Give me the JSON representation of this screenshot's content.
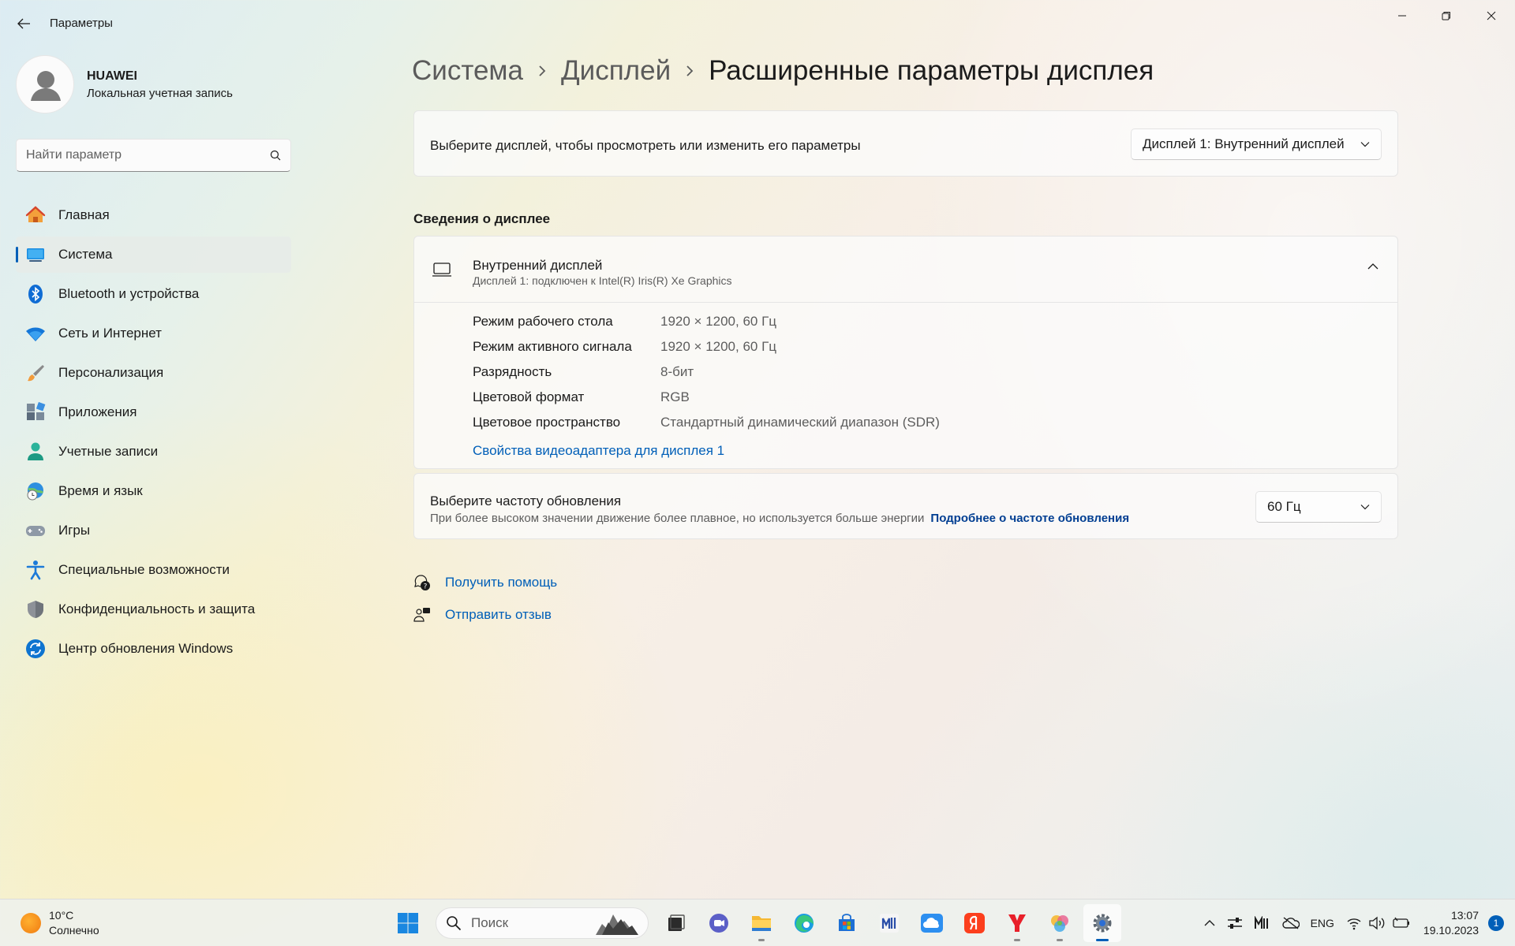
{
  "window": {
    "title": "Параметры"
  },
  "profile": {
    "name": "HUAWEI",
    "account_type": "Локальная учетная запись"
  },
  "search": {
    "placeholder": "Найти параметр"
  },
  "nav": {
    "items": [
      {
        "label": "Главная",
        "icon": "home-icon"
      },
      {
        "label": "Система",
        "icon": "system-icon",
        "active": true
      },
      {
        "label": "Bluetooth и устройства",
        "icon": "bluetooth-icon"
      },
      {
        "label": "Сеть и Интернет",
        "icon": "wifi-icon"
      },
      {
        "label": "Персонализация",
        "icon": "brush-icon"
      },
      {
        "label": "Приложения",
        "icon": "apps-icon"
      },
      {
        "label": "Учетные записи",
        "icon": "person-icon"
      },
      {
        "label": "Время и язык",
        "icon": "globe-clock-icon"
      },
      {
        "label": "Игры",
        "icon": "gamepad-icon"
      },
      {
        "label": "Специальные возможности",
        "icon": "accessibility-icon"
      },
      {
        "label": "Конфиденциальность и защита",
        "icon": "shield-icon"
      },
      {
        "label": "Центр обновления Windows",
        "icon": "update-icon"
      }
    ]
  },
  "breadcrumb": {
    "level1": "Система",
    "level2": "Дисплей",
    "current": "Расширенные параметры дисплея"
  },
  "display_select": {
    "label": "Выберите дисплей, чтобы просмотреть или изменить его параметры",
    "selected": "Дисплей 1: Внутренний дисплей"
  },
  "info_section": {
    "title": "Сведения о дисплее",
    "display_name": "Внутренний дисплей",
    "display_desc": "Дисплей 1: подключен к Intel(R) Iris(R) Xe Graphics",
    "rows": [
      {
        "key": "Режим рабочего стола",
        "value": "1920 × 1200, 60 Гц"
      },
      {
        "key": "Режим активного сигнала",
        "value": "1920 × 1200, 60 Гц"
      },
      {
        "key": "Разрядность",
        "value": "8-бит"
      },
      {
        "key": "Цветовой формат",
        "value": "RGB"
      },
      {
        "key": "Цветовое пространство",
        "value": "Стандартный динамический диапазон (SDR)"
      }
    ],
    "adapter_link": "Свойства видеоадаптера для дисплея 1"
  },
  "refresh": {
    "title": "Выберите частоту обновления",
    "desc": "При более высоком значении движение более плавное, но используется больше энергии",
    "more_link": "Подробнее о частоте обновления",
    "selected": "60 Гц"
  },
  "help": {
    "get_help": "Получить помощь",
    "feedback": "Отправить отзыв"
  },
  "taskbar": {
    "weather_temp": "10°C",
    "weather_desc": "Солнечно",
    "search_placeholder": "Поиск",
    "lang": "ENG",
    "time": "13:07",
    "date": "19.10.2023",
    "notifications": "1"
  },
  "colors": {
    "accent": "#005fb8",
    "link_bold": "#003e92"
  }
}
